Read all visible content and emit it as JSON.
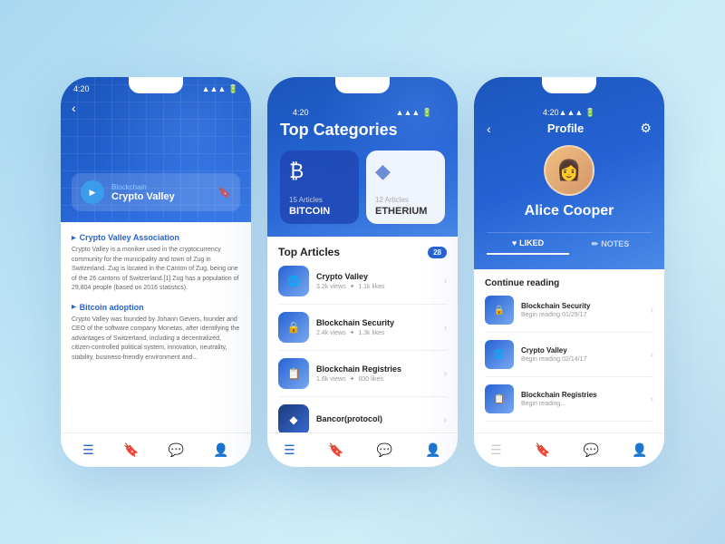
{
  "app": {
    "status_time": "4:20",
    "signal_icon": "●●● ▲ 🔋"
  },
  "phone1": {
    "status_time": "4:20",
    "back_label": "‹",
    "header_category": "Blockchain",
    "header_title": "Crypto Valley",
    "section1_title": "Crypto Valley Association",
    "section1_text": "Crypto Valley is a moniker used in the cryptocurrency community for the municipality and town of Zug in Switzerland. Zug is located in the Canton of Zug, being one of the 26 cantons of Switzerland.[1] Zug has a population of 29,804 people (based on 2016 statistics).",
    "section2_title": "Bitcoin adoption",
    "section2_text": "Crypto Valley was founded by Johann Gevers, founder and CEO of the software company Monetas, after identifying the advantages of Switzerland, including a decentralized, citizen-controlled political system, innovation, neutrality, stability, business-friendly environment and..."
  },
  "phone2": {
    "status_time": "4:20",
    "header_title": "Top Categories",
    "cat1_articles": "15 Articles",
    "cat1_name": "BITCOIN",
    "cat1_icon": "₿",
    "cat2_articles": "12 Articles",
    "cat2_name": "ETHERIUM",
    "cat2_icon": "⬡",
    "top_articles_label": "Top Articles",
    "badge_count": "28",
    "articles": [
      {
        "name": "Crypto Valley",
        "meta": "3.2k views   ✦  1.1k likes",
        "icon": "🌐"
      },
      {
        "name": "Blockchain Security",
        "meta": "2.4k views   ✦  1.3k likes",
        "icon": "🔒"
      },
      {
        "name": "Blockchain Registries",
        "meta": "1.6k views   ✦  600 likes",
        "icon": "📋"
      },
      {
        "name": "Bancor(protocol)",
        "meta": "",
        "icon": "◆"
      }
    ]
  },
  "phone3": {
    "status_time": "4:20",
    "back_label": "‹",
    "profile_title": "Profile",
    "settings_icon": "⚙",
    "avatar_emoji": "👩",
    "user_name": "Alice Cooper",
    "tab1_label": "LIKED",
    "tab1_icon": "♥",
    "tab2_label": "NOTES",
    "tab2_icon": "✏",
    "continue_label": "Continue reading",
    "reading_items": [
      {
        "title": "Blockchain Security",
        "date": "Begin reading 01/29/17",
        "icon": "🔒"
      },
      {
        "title": "Crypto Valley",
        "date": "Begin reading 02/14/17",
        "icon": "🌐"
      },
      {
        "title": "Blockchain Registries",
        "date": "Begin reading...",
        "icon": "📋"
      }
    ]
  }
}
